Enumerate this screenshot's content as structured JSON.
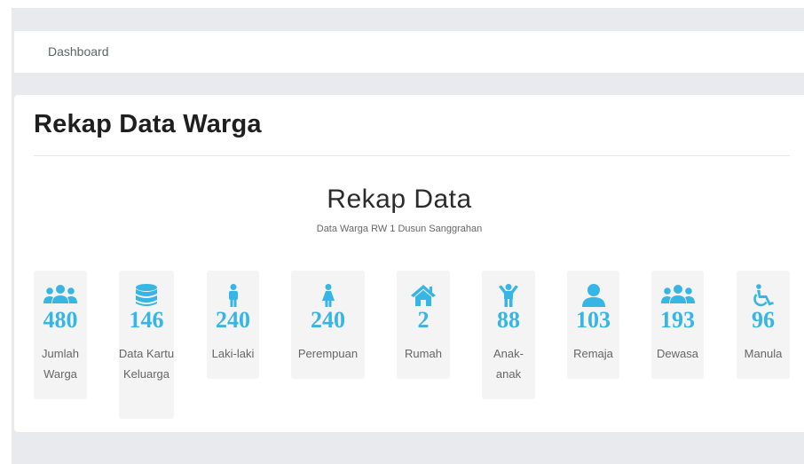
{
  "breadcrumb": "Dashboard",
  "page_title": "Rekap Data Warga",
  "section": {
    "title": "Rekap Data",
    "subtitle": "Data Warga RW 1 Dusun Sanggrahan"
  },
  "accent_color": "#37b5e4",
  "stats": [
    {
      "icon": "users-icon",
      "value": "480",
      "label": "Jumlah Warga"
    },
    {
      "icon": "database-icon",
      "value": "146",
      "label": "Data Kartu Keluarga"
    },
    {
      "icon": "male-icon",
      "value": "240",
      "label": "Laki-laki"
    },
    {
      "icon": "female-icon",
      "value": "240",
      "label": "Perempuan"
    },
    {
      "icon": "home-icon",
      "value": "2",
      "label": "Rumah"
    },
    {
      "icon": "child-icon",
      "value": "88",
      "label": "Anak-anak"
    },
    {
      "icon": "user-icon",
      "value": "103",
      "label": "Remaja"
    },
    {
      "icon": "users-icon",
      "value": "193",
      "label": "Dewasa"
    },
    {
      "icon": "wheelchair-icon",
      "value": "96",
      "label": "Manula"
    }
  ]
}
